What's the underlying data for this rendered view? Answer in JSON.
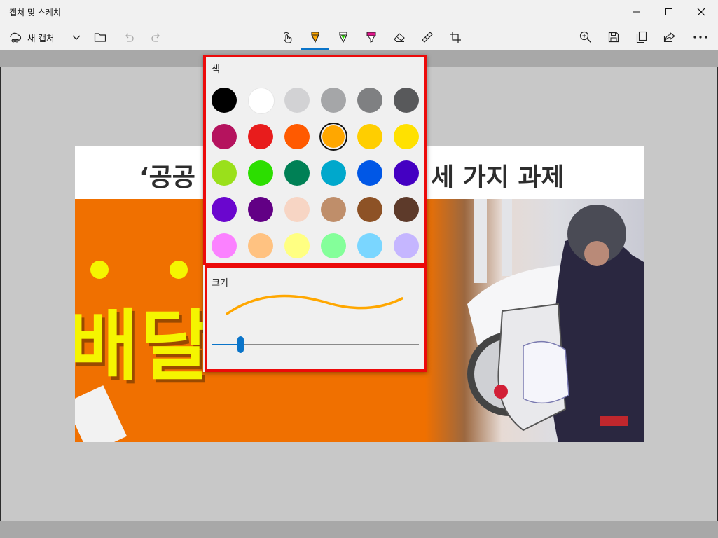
{
  "window": {
    "title": "캡처 및 스케치"
  },
  "toolbar": {
    "new_capture_label": "새 캡처"
  },
  "screenshot": {
    "headline_left": "‘공공",
    "headline_right": "세 가지 과제",
    "banner_text": "배달"
  },
  "panel": {
    "color_label": "색",
    "size_label": "크기",
    "colors": [
      "#000000",
      "#ffffff",
      "#d2d2d4",
      "#a5a6a8",
      "#7f8082",
      "#58595b",
      "#b5135e",
      "#e81c1c",
      "#ff5a00",
      "#ffa700",
      "#ffce00",
      "#ffe100",
      "#9ae01b",
      "#2cde00",
      "#008055",
      "#00a8cc",
      "#0057e6",
      "#4400c2",
      "#6a06ce",
      "#620085",
      "#f7d5c4",
      "#bf8e6a",
      "#8d5226",
      "#5d3a2a",
      "#fb81ff",
      "#ffc281",
      "#ffff82",
      "#84ff9a",
      "#7ad6ff",
      "#c5b6ff"
    ],
    "selected_color": "#ffa700",
    "pen_size_fraction": 0.14
  }
}
